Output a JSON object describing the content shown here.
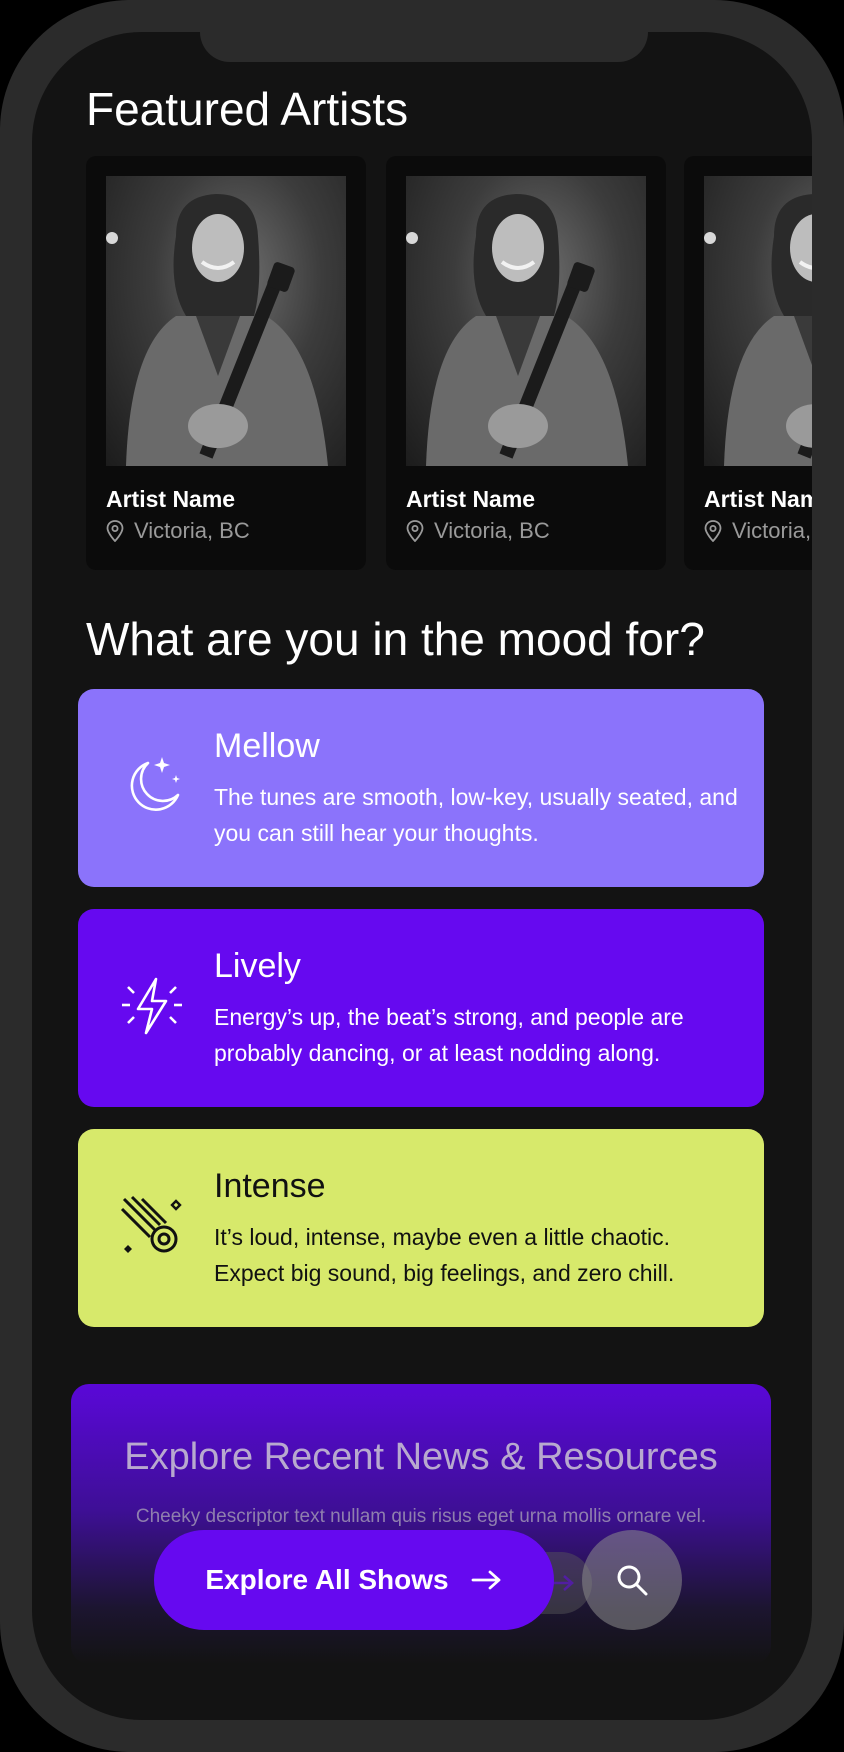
{
  "featured": {
    "title": "Featured Artists",
    "artists": [
      {
        "name": "Artist Name",
        "location": "Victoria, BC"
      },
      {
        "name": "Artist Name",
        "location": "Victoria, BC"
      },
      {
        "name": "Artist Name",
        "location": "Victoria, BC"
      }
    ]
  },
  "mood": {
    "title": "What are you in the mood for?",
    "cards": [
      {
        "title": "Mellow",
        "description": "The tunes are smooth, low-key, usually seated, and you can still hear your thoughts.",
        "icon": "moon-stars-icon",
        "color": "#8b73fb"
      },
      {
        "title": "Lively",
        "description": "Energy’s up, the beat’s strong, and people are probably dancing, or at least nodding along.",
        "icon": "lightning-icon",
        "color": "#6609f0"
      },
      {
        "title": "Intense",
        "description": "It’s loud, intense, maybe even a little chaotic. Expect big sound, big feelings, and zero chill.",
        "icon": "comet-icon",
        "color": "#d7e96b"
      }
    ]
  },
  "news": {
    "title": "Explore Recent News & Resources",
    "description": "Cheeky descriptor text nullam quis risus eget urna mollis ornare vel."
  },
  "actions": {
    "explore_label": "Explore All Shows",
    "explore_icon": "arrow-right-icon",
    "search_icon": "search-icon"
  }
}
